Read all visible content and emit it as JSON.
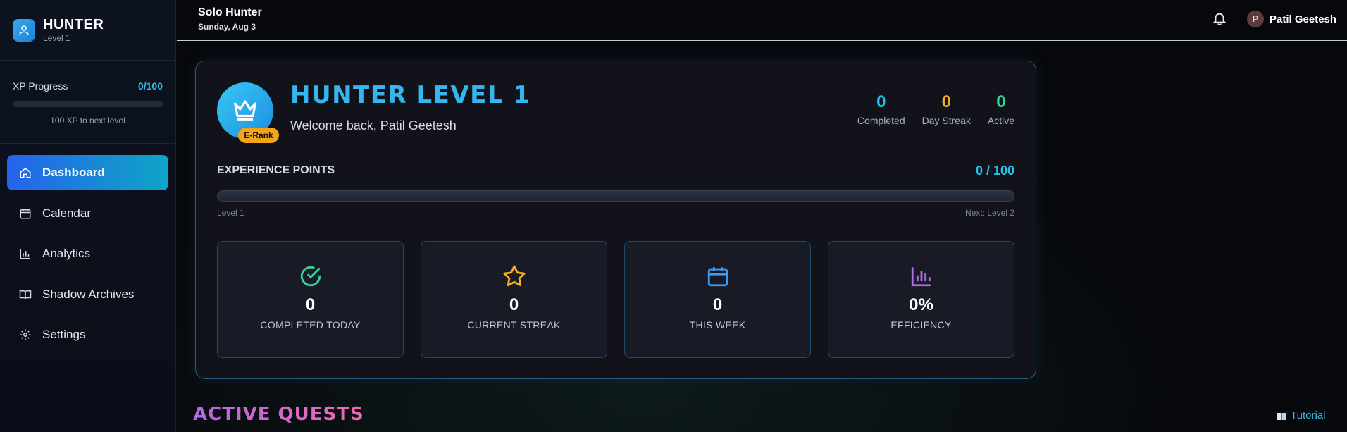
{
  "app": {
    "name": "HUNTER",
    "level_label": "Level 1"
  },
  "xp": {
    "label": "XP Progress",
    "value": "0/100",
    "fraction": 0,
    "note": "100 XP to next level"
  },
  "nav": [
    {
      "label": "Dashboard",
      "icon": "home-icon",
      "active": true
    },
    {
      "label": "Calendar",
      "icon": "calendar-icon",
      "active": false
    },
    {
      "label": "Analytics",
      "icon": "bar-chart-icon",
      "active": false
    },
    {
      "label": "Shadow Archives",
      "icon": "book-icon",
      "active": false
    },
    {
      "label": "Settings",
      "icon": "gear-icon",
      "active": false
    }
  ],
  "topbar": {
    "title": "Solo Hunter",
    "date": "Sunday, Aug 3",
    "user_initial": "P",
    "user_name": "Patil Geetesh"
  },
  "hero": {
    "title": "HUNTER LEVEL 1",
    "welcome": "Welcome back, Patil Geetesh",
    "rank": "E-Rank",
    "stats": [
      {
        "value": "0",
        "label": "Completed",
        "color": "#22c3ee"
      },
      {
        "value": "0",
        "label": "Day Streak",
        "color": "#f2b01e"
      },
      {
        "value": "0",
        "label": "Active",
        "color": "#34d399"
      }
    ],
    "experience": {
      "label": "EXPERIENCE POINTS",
      "value": "0 / 100",
      "fraction": 0,
      "current_level": "Level 1",
      "next_level": "Next: Level 2"
    },
    "cards": [
      {
        "value": "0",
        "label": "COMPLETED TODAY",
        "icon": "check-circle-icon",
        "color": "#34d399"
      },
      {
        "value": "0",
        "label": "CURRENT STREAK",
        "icon": "star-icon",
        "color": "#f2b01e"
      },
      {
        "value": "0",
        "label": "THIS WEEK",
        "icon": "calendar-icon",
        "color": "#3b9cf0"
      },
      {
        "value": "0%",
        "label": "EFFICIENCY",
        "icon": "bar-chart-icon",
        "color": "#b36ae6"
      }
    ]
  },
  "section": {
    "active_quests": "ACTIVE QUESTS"
  },
  "tutorial": {
    "label": "Tutorial"
  }
}
